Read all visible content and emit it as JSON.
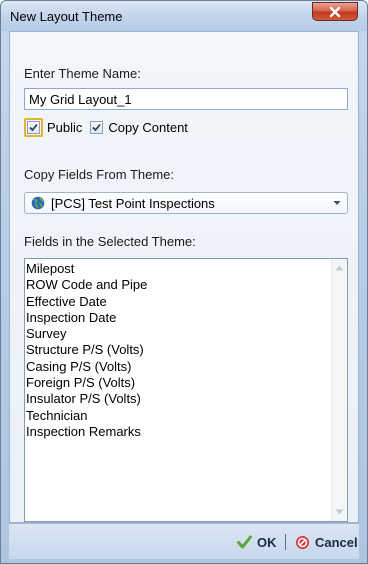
{
  "window": {
    "title": "New Layout Theme",
    "close_glyph": "x"
  },
  "theme_name": {
    "label": "Enter Theme Name:",
    "value": "My Grid Layout_1"
  },
  "checkboxes": {
    "public": {
      "label": "Public",
      "checked": true
    },
    "copy_content": {
      "label": "Copy Content",
      "checked": true
    }
  },
  "copy_fields": {
    "label": "Copy Fields From Theme:",
    "selected": "[PCS] Test Point Inspections",
    "icon": "globe-icon"
  },
  "fields_list": {
    "label": "Fields in the Selected Theme:",
    "items": [
      "Milepost",
      "ROW Code and Pipe",
      "Effective Date",
      "Inspection Date",
      "Survey",
      "Structure P/S (Volts)",
      "Casing P/S (Volts)",
      "Foreign P/S (Volts)",
      "Insulator P/S (Volts)",
      "Technician",
      "Inspection Remarks"
    ]
  },
  "footer": {
    "ok_label": "OK",
    "cancel_label": "Cancel",
    "ok_icon": "checkmark-icon",
    "cancel_icon": "cancel-icon"
  },
  "colors": {
    "accent": "#3f6fb6",
    "ok_green": "#5aa832",
    "cancel_red": "#d8343a"
  }
}
